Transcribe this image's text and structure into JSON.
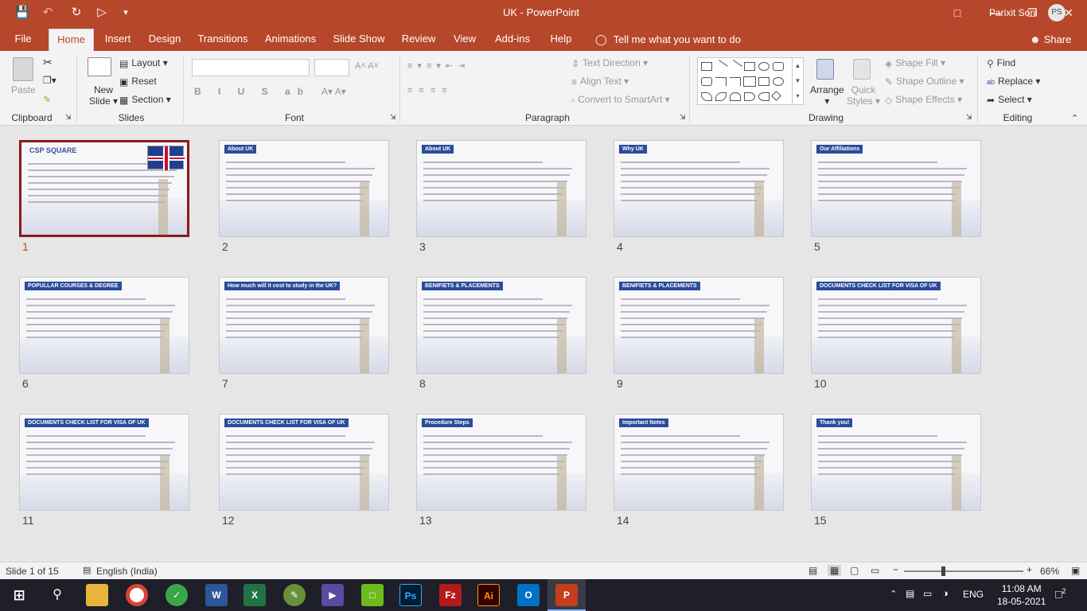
{
  "window": {
    "title": "UK  -  PowerPoint",
    "user_name": "Parixit Soni",
    "user_initials": "PS"
  },
  "colors": {
    "accent": "#b7472a",
    "selected_number": "#c43e1c",
    "slide_band": "#2b4c9b"
  },
  "quick_access": [
    {
      "name": "save-icon"
    },
    {
      "name": "undo-icon"
    },
    {
      "name": "redo-icon"
    },
    {
      "name": "present-from-start-icon"
    }
  ],
  "tabs": [
    "File",
    "Home",
    "Insert",
    "Design",
    "Transitions",
    "Animations",
    "Slide Show",
    "Review",
    "View",
    "Add-ins",
    "Help"
  ],
  "active_tab": "Home",
  "tell_me": "Tell me what you want to do",
  "share": "Share",
  "ribbon": {
    "clipboard": {
      "paste": "Paste",
      "group": "Clipboard"
    },
    "slides": {
      "new_slide_line1": "New",
      "new_slide_line2": "Slide",
      "layout": "Layout",
      "reset": "Reset",
      "section": "Section",
      "group": "Slides"
    },
    "font": {
      "group": "Font"
    },
    "paragraph": {
      "text_direction": "Text Direction",
      "align_text": "Align Text",
      "convert_smartart": "Convert to SmartArt",
      "group": "Paragraph"
    },
    "drawing": {
      "arrange": "Arrange",
      "quick_styles_line1": "Quick",
      "quick_styles_line2": "Styles",
      "shape_fill": "Shape Fill",
      "shape_outline": "Shape Outline",
      "shape_effects": "Shape Effects",
      "group": "Drawing"
    },
    "editing": {
      "find": "Find",
      "replace": "Replace",
      "select": "Select",
      "group": "Editing"
    }
  },
  "slides": [
    {
      "number": "1",
      "title": "CSP SQUARE"
    },
    {
      "number": "2",
      "title": "About UK"
    },
    {
      "number": "3",
      "title": "About UK"
    },
    {
      "number": "4",
      "title": "Why UK"
    },
    {
      "number": "5",
      "title": "Our Affiliations"
    },
    {
      "number": "6",
      "title": "POPULLAR COURSES & DEGREE"
    },
    {
      "number": "7",
      "title": "How much will it cost to study in the UK?"
    },
    {
      "number": "8",
      "title": "BENIFIETS & PLACEMENTS"
    },
    {
      "number": "9",
      "title": "BENIFIETS & PLACEMENTS"
    },
    {
      "number": "10",
      "title": "DOCUMENTS CHECK LIST FOR VISA OF UK"
    },
    {
      "number": "11",
      "title": "DOCUMENTS CHECK LIST FOR VISA OF UK"
    },
    {
      "number": "12",
      "title": "DOCUMENTS CHECK LIST FOR VISA OF UK"
    },
    {
      "number": "13",
      "title": "Procedure Steps"
    },
    {
      "number": "14",
      "title": "Important Notes"
    },
    {
      "number": "15",
      "title": "Thank you!"
    }
  ],
  "selected_slide": "1",
  "status": {
    "slide_info": "Slide 1 of 15",
    "language": "English (India)",
    "zoom": "66%",
    "zoom_fraction": 0.66
  },
  "taskbar": {
    "lang": "ENG",
    "time": "11:08 AM",
    "date": "18-05-2021",
    "notifications": "2"
  }
}
